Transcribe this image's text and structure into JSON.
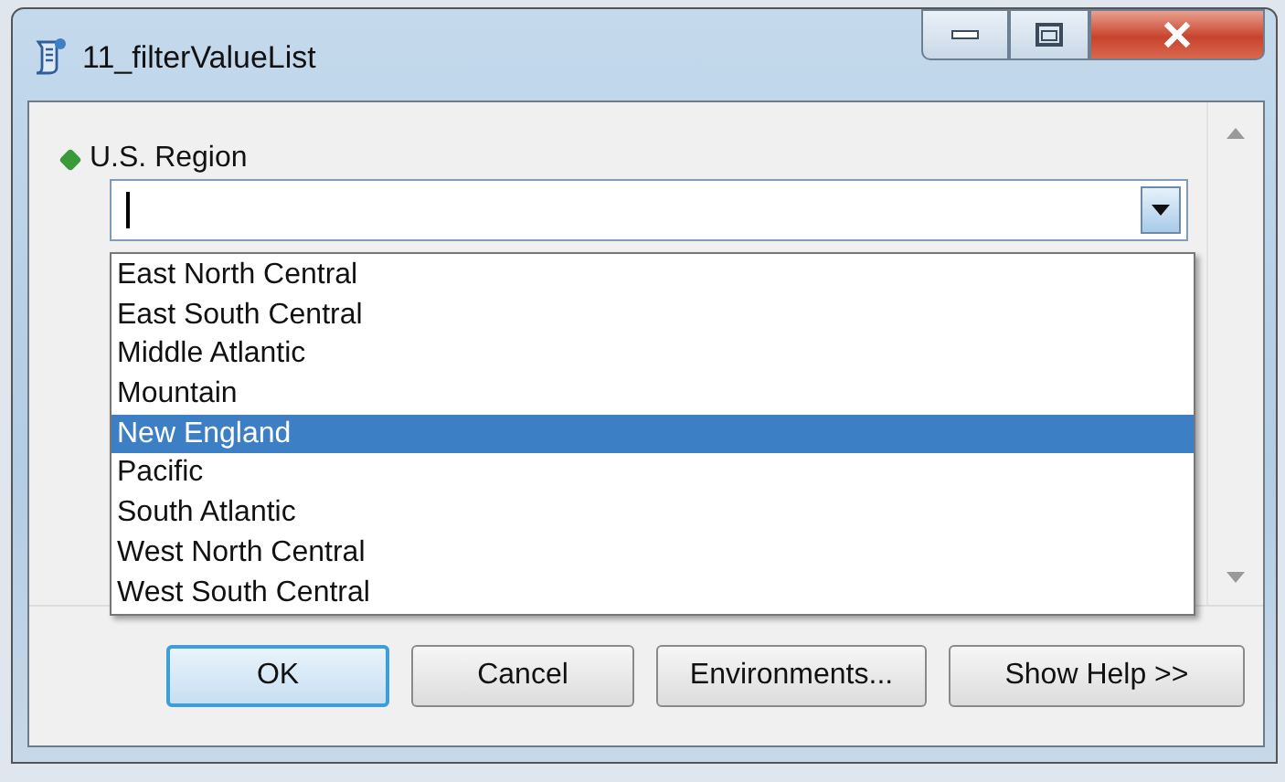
{
  "window": {
    "title": "11_filterValueList"
  },
  "parameter": {
    "label": "U.S. Region",
    "required": true,
    "options": [
      {
        "label": "East North Central",
        "selected": false
      },
      {
        "label": "East South Central",
        "selected": false
      },
      {
        "label": "Middle Atlantic",
        "selected": false
      },
      {
        "label": "Mountain",
        "selected": false
      },
      {
        "label": "New England",
        "selected": true
      },
      {
        "label": "Pacific",
        "selected": false
      },
      {
        "label": "South Atlantic",
        "selected": false
      },
      {
        "label": "West North Central",
        "selected": false
      },
      {
        "label": "West South Central",
        "selected": false
      }
    ]
  },
  "buttons": [
    {
      "label": "OK",
      "default": true
    },
    {
      "label": "Cancel",
      "default": false
    },
    {
      "label": "Environments...",
      "default": false
    },
    {
      "label": "Show Help >>",
      "default": false
    }
  ]
}
